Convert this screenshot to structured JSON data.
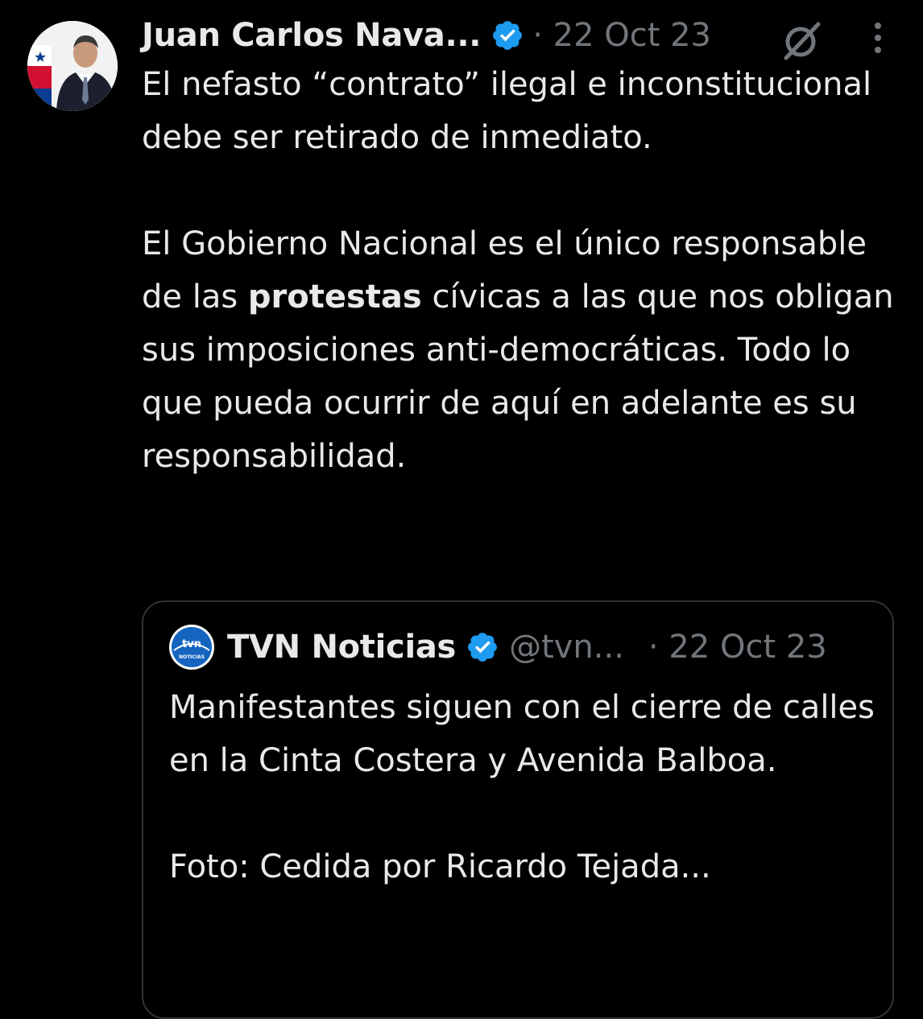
{
  "tweet": {
    "author_name": "Juan Carlos Nava...",
    "date": "· 22 Oct 23",
    "paragraph1": "El nefasto “contrato” ilegal e inconstitucional debe ser retirado de inmediato.",
    "paragraph2_before": "El Gobierno Nacional es el único responsable de las ",
    "paragraph2_bold": "protestas",
    "paragraph2_after": " cívicas a las que nos obligan sus imposiciones anti-democráticas. Todo lo que pueda ocurrir de aquí en adelante es su responsabilidad.",
    "avatar_icon": "profile-avatar",
    "verified_icon": "verified-badge-icon",
    "grok_icon": "grok-icon",
    "more_icon": "more-options-icon"
  },
  "quote": {
    "author_name": "TVN Noticias",
    "handle": "@tvn...",
    "date": "· 22 Oct 23",
    "avatar_text": "tvn",
    "avatar_subtext": "NOTICIAS",
    "text1": "Manifestantes siguen con el cierre de calles en la Cinta Costera y Avenida Balboa.",
    "text2": "Foto: Cedida por Ricardo Tejada..."
  },
  "colors": {
    "background": "#000000",
    "text": "#e7e9ea",
    "secondary": "#71767b",
    "verified": "#1d9bf0",
    "border": "#2f3336",
    "tvn_blue": "#1565c0"
  }
}
